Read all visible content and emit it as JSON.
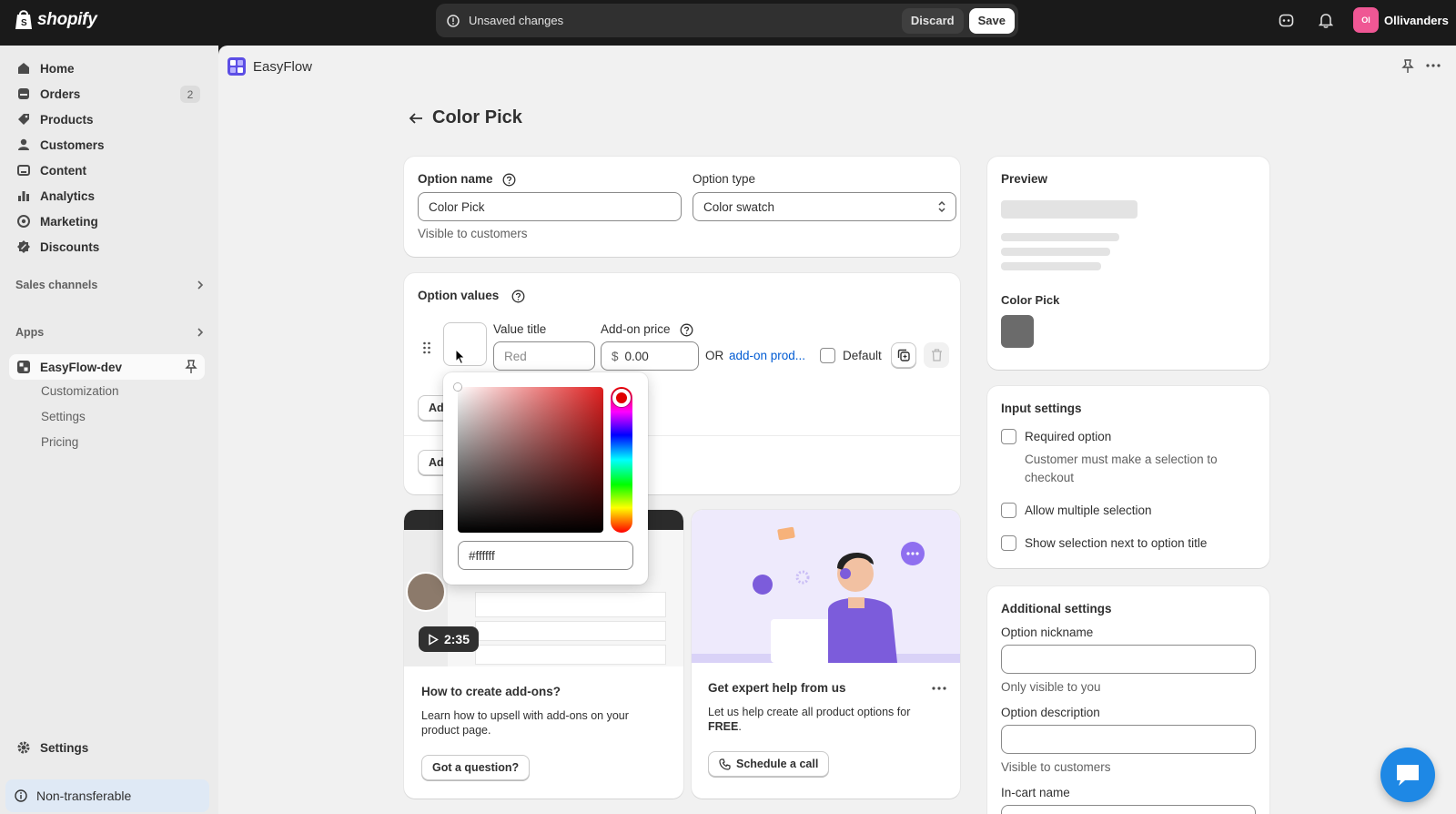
{
  "topbar": {
    "brand": "shopify",
    "unsaved_text": "Unsaved changes",
    "discard_label": "Discard",
    "save_label": "Save",
    "store_initials": "Ol",
    "store_name": "Ollivanders"
  },
  "sidebar": {
    "items": [
      {
        "label": "Home",
        "icon": "home-icon"
      },
      {
        "label": "Orders",
        "icon": "orders-icon",
        "badge": "2"
      },
      {
        "label": "Products",
        "icon": "tag-icon"
      },
      {
        "label": "Customers",
        "icon": "person-icon"
      },
      {
        "label": "Content",
        "icon": "content-icon"
      },
      {
        "label": "Analytics",
        "icon": "bar-chart-icon"
      },
      {
        "label": "Marketing",
        "icon": "target-icon"
      },
      {
        "label": "Discounts",
        "icon": "discount-icon"
      }
    ],
    "sales_channels": "Sales channels",
    "apps": "Apps",
    "app_name": "EasyFlow-dev",
    "sub_items": [
      "Customization",
      "Settings",
      "Pricing"
    ],
    "settings": "Settings",
    "non_transferable": "Non-transferable"
  },
  "app_header": {
    "title": "EasyFlow"
  },
  "page": {
    "title": "Color Pick"
  },
  "option_card": {
    "name_label": "Option name",
    "name_value": "Color Pick",
    "name_hint": "Visible to customers",
    "type_label": "Option type",
    "type_value": "Color swatch"
  },
  "values_card": {
    "title": "Option values",
    "value_title_label": "Value title",
    "value_title_placeholder": "Red",
    "addon_price_label": "Add-on price",
    "currency": "$",
    "price_value": "0.00",
    "or_text": "OR",
    "addon_link": "add-on prod...",
    "default_label": "Default",
    "add_btn_1": "Ad",
    "add_btn_2": "Ad"
  },
  "color_picker": {
    "hex_value": "#ffffff",
    "hue_color": "#e00000"
  },
  "video_card": {
    "duration": "2:35",
    "title": "How to create add-ons?",
    "desc": "Learn how to upsell with add-ons on your product page.",
    "button": "Got a question?"
  },
  "help_card": {
    "title": "Get expert help from us",
    "desc_pre": "Let us help create all product options for ",
    "desc_bold": "FREE",
    "desc_post": ".",
    "button": "Schedule a call"
  },
  "preview_card": {
    "title": "Preview",
    "option_label": "Color Pick",
    "swatch_color": "#6b6b6b"
  },
  "input_settings": {
    "title": "Input settings",
    "required": "Required option",
    "required_hint": "Customer must make a selection to checkout",
    "multiple": "Allow multiple selection",
    "show_selection": "Show selection next to option title"
  },
  "additional_settings": {
    "title": "Additional settings",
    "nickname_label": "Option nickname",
    "nickname_hint": "Only visible to you",
    "description_label": "Option description",
    "description_hint": "Visible to customers",
    "incart_label": "In-cart name"
  }
}
